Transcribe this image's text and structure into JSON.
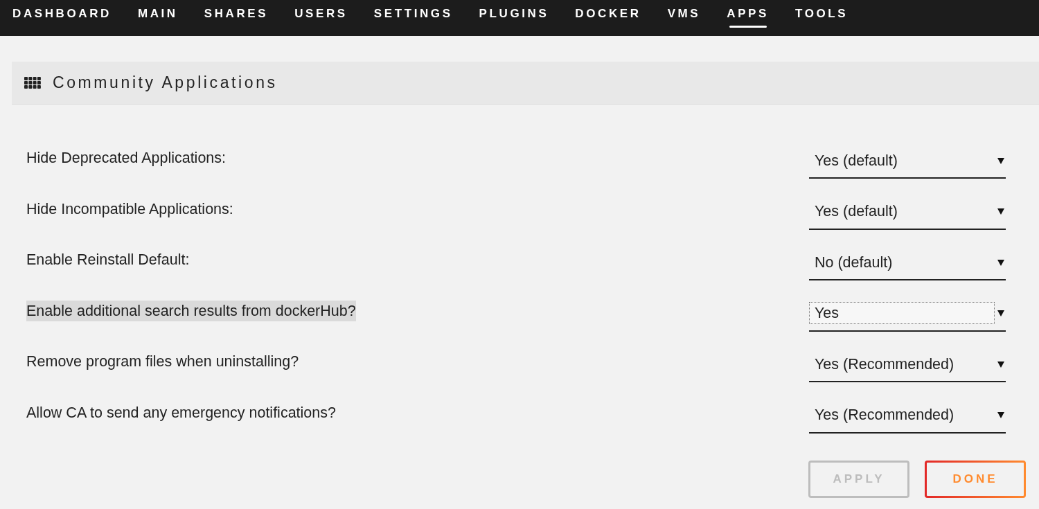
{
  "nav": {
    "items": [
      {
        "label": "DASHBOARD",
        "selected": false
      },
      {
        "label": "MAIN",
        "selected": false
      },
      {
        "label": "SHARES",
        "selected": false
      },
      {
        "label": "USERS",
        "selected": false
      },
      {
        "label": "SETTINGS",
        "selected": false
      },
      {
        "label": "PLUGINS",
        "selected": false
      },
      {
        "label": "DOCKER",
        "selected": false
      },
      {
        "label": "VMS",
        "selected": false
      },
      {
        "label": "APPS",
        "selected": true
      },
      {
        "label": "TOOLS",
        "selected": false
      }
    ]
  },
  "section": {
    "title": "Community Applications"
  },
  "settings": [
    {
      "label": "Hide Deprecated Applications:",
      "highlighted": false,
      "value": "Yes (default)",
      "focused": false
    },
    {
      "label": "Hide Incompatible Applications:",
      "highlighted": false,
      "value": "Yes (default)",
      "focused": false
    },
    {
      "label": "Enable Reinstall Default:",
      "highlighted": false,
      "value": "No (default)",
      "focused": false
    },
    {
      "label": "Enable additional search results from dockerHub?",
      "highlighted": true,
      "value": "Yes",
      "focused": true
    },
    {
      "label": "Remove program files when uninstalling?",
      "highlighted": false,
      "value": "Yes (Recommended)",
      "focused": false
    },
    {
      "label": "Allow CA to send any emergency notifications?",
      "highlighted": false,
      "value": "Yes (Recommended)",
      "focused": false
    }
  ],
  "buttons": [
    {
      "label": "APPLY",
      "disabled": true
    },
    {
      "label": "DONE",
      "disabled": false
    }
  ]
}
